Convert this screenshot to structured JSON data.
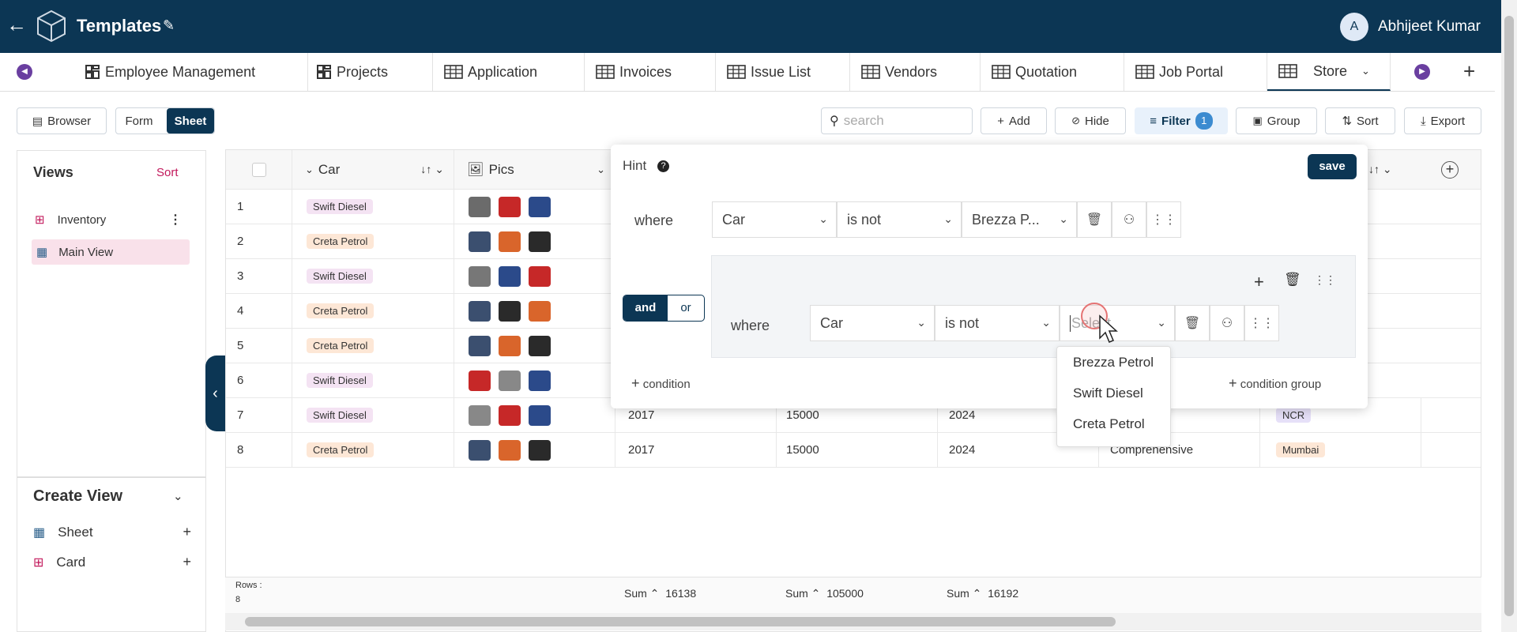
{
  "app": {
    "title": "Templates",
    "user_initial": "A",
    "user_name": "Abhijeet Kumar"
  },
  "tabs": [
    "Employee Management",
    "Projects",
    "Application",
    "Invoices",
    "Issue List",
    "Vendors",
    "Quotation",
    "Job Portal",
    "Store"
  ],
  "toolbar": {
    "browser": "Browser",
    "form": "Form",
    "sheet": "Sheet",
    "search_placeholder": "search",
    "add": "Add",
    "hide": "Hide",
    "filter": "Filter",
    "filter_count": "1",
    "group": "Group",
    "sort": "Sort",
    "export": "Export"
  },
  "views": {
    "title": "Views",
    "sort": "Sort",
    "items": [
      "Inventory",
      "Main View"
    ]
  },
  "create_view": {
    "title": "Create View",
    "items": [
      "Sheet",
      "Card"
    ]
  },
  "columns": {
    "car": "Car",
    "pics": "Pics"
  },
  "rows": [
    {
      "n": "1",
      "car": "Swift Diesel",
      "pics": [
        "#6b6b6b",
        "#c62828",
        "#2b4a8a"
      ]
    },
    {
      "n": "2",
      "car": "Creta Petrol",
      "pics": [
        "#3b4f6f",
        "#d9652b",
        "#2a2a2a"
      ]
    },
    {
      "n": "3",
      "car": "Swift Diesel",
      "pics": [
        "#777777",
        "#2b4a8a",
        "#c62828"
      ]
    },
    {
      "n": "4",
      "car": "Creta Petrol",
      "pics": [
        "#3b4f6f",
        "#2a2a2a",
        "#d9652b"
      ]
    },
    {
      "n": "5",
      "car": "Creta Petrol",
      "pics": [
        "#3b4f6f",
        "#d9652b",
        "#2a2a2a"
      ]
    },
    {
      "n": "6",
      "car": "Swift Diesel",
      "pics": [
        "#c62828",
        "#888888",
        "#2b4a8a"
      ]
    },
    {
      "n": "7",
      "car": "Swift Diesel",
      "c4": "2017",
      "c5": "15000",
      "c6": "2024",
      "c7": "...ensive",
      "c8": "NCR",
      "pics": [
        "#888888",
        "#c62828",
        "#2b4a8a"
      ]
    },
    {
      "n": "8",
      "car": "Creta Petrol",
      "c4": "2017",
      "c5": "15000",
      "c6": "2024",
      "c7": "Comprehensive",
      "c8": "Mumbai",
      "pics": [
        "#3b4f6f",
        "#d9652b",
        "#2a2a2a"
      ]
    }
  ],
  "filter": {
    "hint": "Hint",
    "save": "save",
    "where": "where",
    "field1": "Car",
    "op1": "is not",
    "val1": "Brezza P...",
    "and": "and",
    "or": "or",
    "field2": "Car",
    "op2": "is not",
    "val2_placeholder": "Select",
    "add_condition": "condition",
    "add_group": "condition group"
  },
  "dropdown_options": [
    "Brezza Petrol",
    "Swift Diesel",
    "Creta Petrol"
  ],
  "footer": {
    "rows_label": "Rows :",
    "rows_count": "8",
    "sum_label": "Sum",
    "sum1": "16138",
    "sum2": "105000",
    "sum3": "16192"
  },
  "colors": {
    "header": "#0c3654",
    "accent": "#1a3a5a",
    "swift_tag": "#f4e3f3",
    "creta_tag": "#fde7d6",
    "ncr_tag": "#e6e0f8",
    "mumbai_tag": "#fde7d6"
  }
}
